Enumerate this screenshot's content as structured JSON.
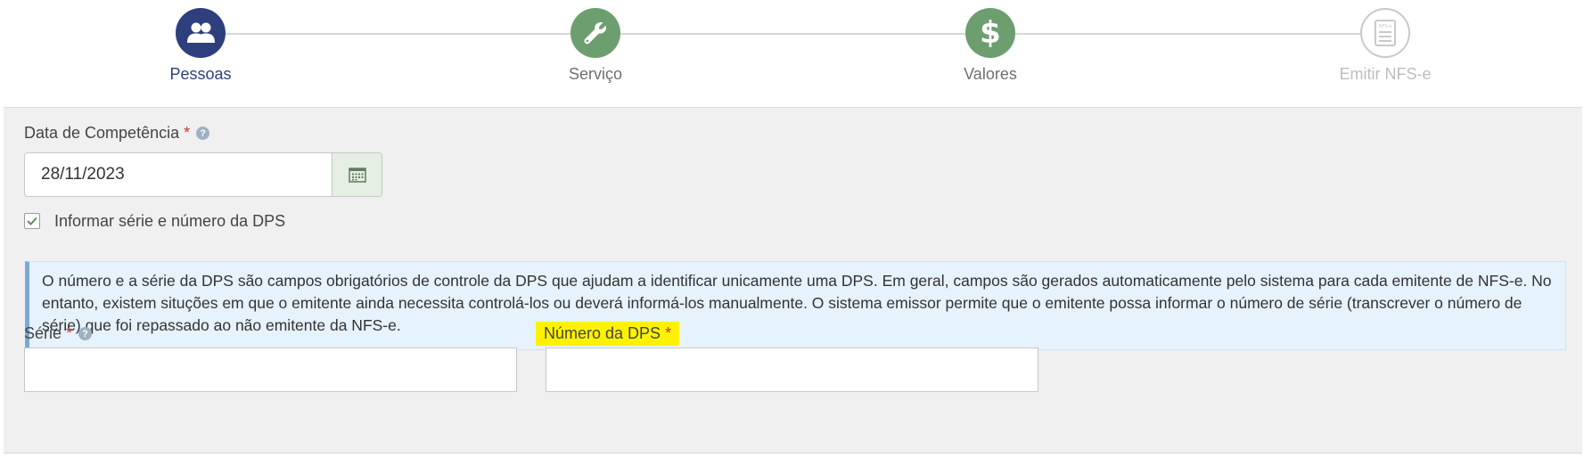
{
  "wizard": {
    "steps": [
      {
        "label": "Pessoas",
        "state": "active",
        "icon": "people-icon",
        "color": "#2e3f7e"
      },
      {
        "label": "Serviço",
        "state": "complete",
        "icon": "wrench-icon",
        "color": "#6d9e6f"
      },
      {
        "label": "Valores",
        "state": "complete",
        "icon": "dollar-icon",
        "color": "#6d9e6f"
      },
      {
        "label": "Emitir NFS-e",
        "state": "disabled",
        "icon": "nfse-document-icon",
        "icon_text": "NFS-e",
        "color": "#bdbdbd"
      }
    ]
  },
  "form": {
    "competencia": {
      "label": "Data de Competência",
      "required_mark": "*",
      "value": "28/11/2023",
      "button_icon": "calendar-icon"
    },
    "informar_serie": {
      "label": "Informar série e número da DPS",
      "checked": true
    },
    "info_text": "O número e a série da DPS são campos obrigatórios de controle da DPS que ajudam a identificar unicamente uma DPS. Em geral, campos são gerados automaticamente pelo sistema para cada emitente de NFS-e. No entanto, existem situções em que o emitente ainda necessita controlá-los ou deverá informá-los manualmente. O sistema emissor permite que o emitente possa informar o número de série (transcrever o número de série) que foi repassado ao não emitente da NFS-e.",
    "serie": {
      "label": "Série",
      "required_mark": "*",
      "value": ""
    },
    "numero_dps": {
      "label": "Número da DPS",
      "required_mark": "*",
      "value": "",
      "highlight_color": "#fff200"
    }
  },
  "colors": {
    "primary": "#2e3f7e",
    "success": "#6d9e6f",
    "required": "#c0392b",
    "info_bg": "#e6f2fc"
  }
}
